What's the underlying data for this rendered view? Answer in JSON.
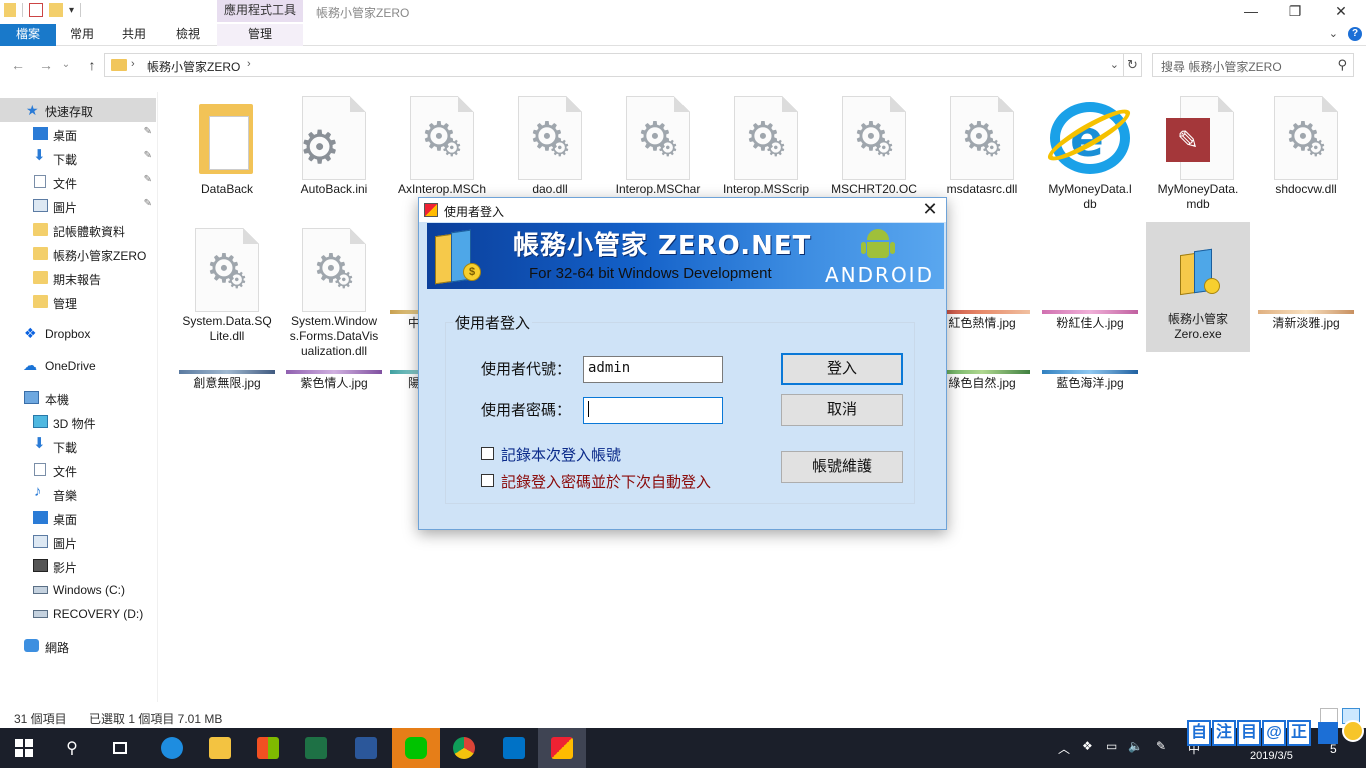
{
  "window": {
    "title": "帳務小管家ZERO",
    "context_tab_group": "應用程式工具",
    "controls": {
      "minimize": "—",
      "maximize": "❐",
      "close": "✕"
    }
  },
  "ribbon": {
    "tabs": [
      "檔案",
      "常用",
      "共用",
      "檢視",
      "管理"
    ],
    "help": "?",
    "expand": "⌄"
  },
  "address": {
    "path": "帳務小管家ZERO",
    "sep": "›",
    "back": "←",
    "forward": "→",
    "recent": "⌄",
    "up": "↑",
    "dropdown": "⌄",
    "refresh": "↻",
    "search_placeholder": "搜尋 帳務小管家ZERO"
  },
  "nav": {
    "quick_access": "快速存取",
    "items": [
      {
        "label": "桌面",
        "icon": "desktop-icon",
        "pinned": true
      },
      {
        "label": "下載",
        "icon": "download-icon",
        "pinned": true
      },
      {
        "label": "文件",
        "icon": "document-icon",
        "pinned": true
      },
      {
        "label": "圖片",
        "icon": "picture-icon",
        "pinned": true
      },
      {
        "label": "記帳體軟資料",
        "icon": "folder-icon",
        "pinned": false
      },
      {
        "label": "帳務小管家ZERO",
        "icon": "folder-icon",
        "pinned": false
      },
      {
        "label": "期末報告",
        "icon": "folder-icon",
        "pinned": false
      },
      {
        "label": "管理",
        "icon": "folder-icon",
        "pinned": false
      }
    ],
    "dropbox": "Dropbox",
    "onedrive": "OneDrive",
    "thispc": "本機",
    "pc_items": [
      {
        "label": "3D 物件",
        "icon": "3d-objects-icon"
      },
      {
        "label": "下載",
        "icon": "download-icon"
      },
      {
        "label": "文件",
        "icon": "document-icon"
      },
      {
        "label": "音樂",
        "icon": "music-icon"
      },
      {
        "label": "桌面",
        "icon": "desktop-icon"
      },
      {
        "label": "圖片",
        "icon": "picture-icon"
      },
      {
        "label": "影片",
        "icon": "video-icon"
      },
      {
        "label": "Windows (C:)",
        "icon": "drive-icon"
      },
      {
        "label": "RECOVERY (D:)",
        "icon": "drive-icon"
      }
    ],
    "network": "網路"
  },
  "files": {
    "row1": [
      {
        "name": "DataBack",
        "kind": "folder"
      },
      {
        "name": "AutoBack.ini",
        "kind": "gear"
      },
      {
        "name": "AxInterop.MSCh\na",
        "kind": "gear"
      },
      {
        "name": "dao.dll",
        "kind": "gear"
      },
      {
        "name": "Interop.MSChar",
        "kind": "gear"
      },
      {
        "name": "Interop.MSScrip",
        "kind": "gear"
      },
      {
        "name": "MSCHRT20.OC",
        "kind": "gear"
      },
      {
        "name": "msdatasrc.dll",
        "kind": "gear"
      },
      {
        "name": "MyMoneyData.l\ndb",
        "kind": "ie"
      },
      {
        "name": "MyMoneyData.\nmdb",
        "kind": "access"
      },
      {
        "name": "shdocvw.dll",
        "kind": "gear"
      }
    ],
    "row2": [
      {
        "name": "System.Data.SQ\nLite.dll",
        "kind": "gear"
      },
      {
        "name": "System.Window\ns.Forms.DataVis\nualization.dll",
        "kind": "gear"
      },
      {
        "name": "中",
        "kind": "jpg"
      },
      {
        "name": "紅色熱情.jpg",
        "kind": "jpg"
      },
      {
        "name": "粉紅佳人.jpg",
        "kind": "jpg"
      },
      {
        "name": "帳務小管家\nZero.exe",
        "kind": "exe"
      },
      {
        "name": "清新淡雅.jpg",
        "kind": "jpg"
      }
    ],
    "row3": [
      {
        "name": "創意無限.jpg"
      },
      {
        "name": "紫色情人.jpg"
      },
      {
        "name": "陽"
      },
      {
        "name": "綠色自然.jpg"
      },
      {
        "name": "藍色海洋.jpg"
      }
    ]
  },
  "status": {
    "count": "31 個項目",
    "selected": "已選取 1 個項目 7.01 MB"
  },
  "dialog": {
    "title": "使用者登入",
    "close": "✕",
    "banner_title": "帳務小管家 ZERO.NET",
    "banner_sub": "For 32-64 bit Windows Development",
    "banner_android": "ANDROID",
    "coin": "$",
    "group_label": "使用者登入",
    "user_label": "使用者代號：",
    "user_value": "admin",
    "pass_label": "使用者密碼：",
    "pass_value": "",
    "remember_account": "記錄本次登入帳號",
    "remember_password": "記錄登入密碼並於下次自動登入",
    "remember_account_checked": false,
    "remember_password_checked": false,
    "login_button": "登入",
    "cancel_button": "取消",
    "account_button": "帳號維護",
    "colors": {
      "remember_account": "#0a2a8a",
      "remember_password": "#8a0a0a"
    }
  },
  "taskbar": {
    "apps": [
      "start-icon",
      "search-icon",
      "task-view-icon",
      "edge-icon",
      "file-explorer-icon",
      "store-icon",
      "excel-icon",
      "word-icon",
      "line-icon",
      "chrome-icon",
      "outlook-icon",
      "zero-app-icon"
    ],
    "ime": [
      "自",
      "注",
      "目",
      "@",
      "正"
    ],
    "ime_lang": "中",
    "date": "2019/3/5",
    "notifications": "5"
  }
}
